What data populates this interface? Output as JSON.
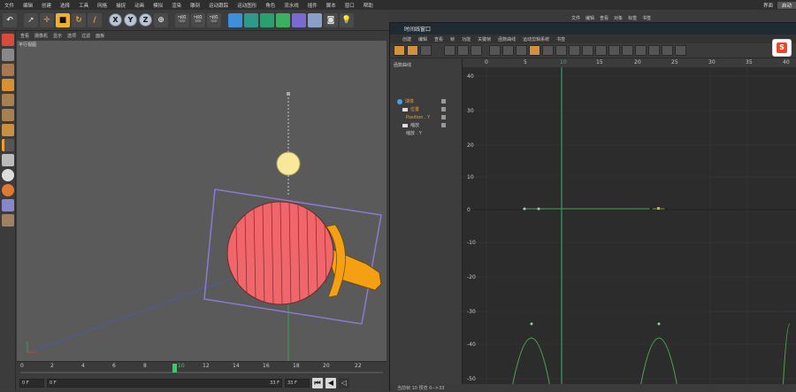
{
  "menubar": {
    "items": [
      "文件",
      "编辑",
      "创建",
      "选择",
      "工具",
      "网格",
      "捕捉",
      "动画",
      "模拟",
      "渲染",
      "雕刻",
      "运动跟踪",
      "运动图形",
      "角色",
      "流水线",
      "插件",
      "脚本",
      "窗口",
      "帮助"
    ],
    "right": [
      "界面",
      "启动"
    ]
  },
  "toolbar": {
    "axis_x": "X",
    "axis_y": "Y",
    "axis_z": "Z"
  },
  "viewport": {
    "menu": [
      "查看",
      "摄像机",
      "显示",
      "选项",
      "过滤",
      "面板"
    ],
    "title": "平行视图"
  },
  "timeline": {
    "ticks": [
      "0",
      "2",
      "4",
      "6",
      "8",
      "10",
      "12",
      "14",
      "16",
      "18",
      "20",
      "22"
    ],
    "current_frame": "10",
    "start_field": "0 F",
    "start_field2": "0 F",
    "end_field": "33 F",
    "end_field2": "33 F"
  },
  "right_top_menu": [
    "文件",
    "编辑",
    "查看",
    "对象",
    "标签",
    "书签"
  ],
  "tlwin": {
    "title": "时间线窗口",
    "menu": [
      "创建",
      "编辑",
      "查看",
      "帧",
      "功能",
      "关键帧",
      "函数曲线",
      "运动剪辑系统",
      "书签"
    ],
    "ruler": [
      "0",
      "5",
      "10",
      "15",
      "20",
      "25",
      "30",
      "35",
      "40"
    ],
    "tree_header": "函数曲线",
    "tree": [
      {
        "label": "球体",
        "indent": 0
      },
      {
        "label": "位置",
        "indent": 1
      },
      {
        "label": "Position . Y",
        "indent": 2
      },
      {
        "label": "缩放",
        "indent": 1
      },
      {
        "label": "缩放 . Y",
        "indent": 2
      }
    ],
    "y_labels": [
      "40",
      "30",
      "20",
      "10",
      "0",
      "-10",
      "-20",
      "-30",
      "-40",
      "-50"
    ],
    "status": "当前帧 10  预览 0-->33"
  },
  "colors": {
    "accent": "#f0a030",
    "curve": "#4aa84a",
    "playhead": "#3ab07a",
    "paddle_face": "#f0666a",
    "paddle_handle": "#f4a012",
    "ball": "#f8e89a"
  }
}
